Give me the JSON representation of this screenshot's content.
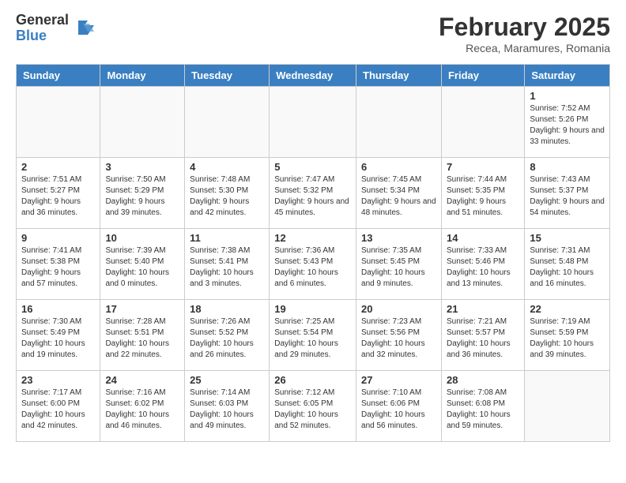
{
  "logo": {
    "general": "General",
    "blue": "Blue"
  },
  "header": {
    "month": "February 2025",
    "location": "Recea, Maramures, Romania"
  },
  "weekdays": [
    "Sunday",
    "Monday",
    "Tuesday",
    "Wednesday",
    "Thursday",
    "Friday",
    "Saturday"
  ],
  "weeks": [
    [
      {
        "day": "",
        "info": ""
      },
      {
        "day": "",
        "info": ""
      },
      {
        "day": "",
        "info": ""
      },
      {
        "day": "",
        "info": ""
      },
      {
        "day": "",
        "info": ""
      },
      {
        "day": "",
        "info": ""
      },
      {
        "day": "1",
        "info": "Sunrise: 7:52 AM\nSunset: 5:26 PM\nDaylight: 9 hours and 33 minutes."
      }
    ],
    [
      {
        "day": "2",
        "info": "Sunrise: 7:51 AM\nSunset: 5:27 PM\nDaylight: 9 hours and 36 minutes."
      },
      {
        "day": "3",
        "info": "Sunrise: 7:50 AM\nSunset: 5:29 PM\nDaylight: 9 hours and 39 minutes."
      },
      {
        "day": "4",
        "info": "Sunrise: 7:48 AM\nSunset: 5:30 PM\nDaylight: 9 hours and 42 minutes."
      },
      {
        "day": "5",
        "info": "Sunrise: 7:47 AM\nSunset: 5:32 PM\nDaylight: 9 hours and 45 minutes."
      },
      {
        "day": "6",
        "info": "Sunrise: 7:45 AM\nSunset: 5:34 PM\nDaylight: 9 hours and 48 minutes."
      },
      {
        "day": "7",
        "info": "Sunrise: 7:44 AM\nSunset: 5:35 PM\nDaylight: 9 hours and 51 minutes."
      },
      {
        "day": "8",
        "info": "Sunrise: 7:43 AM\nSunset: 5:37 PM\nDaylight: 9 hours and 54 minutes."
      }
    ],
    [
      {
        "day": "9",
        "info": "Sunrise: 7:41 AM\nSunset: 5:38 PM\nDaylight: 9 hours and 57 minutes."
      },
      {
        "day": "10",
        "info": "Sunrise: 7:39 AM\nSunset: 5:40 PM\nDaylight: 10 hours and 0 minutes."
      },
      {
        "day": "11",
        "info": "Sunrise: 7:38 AM\nSunset: 5:41 PM\nDaylight: 10 hours and 3 minutes."
      },
      {
        "day": "12",
        "info": "Sunrise: 7:36 AM\nSunset: 5:43 PM\nDaylight: 10 hours and 6 minutes."
      },
      {
        "day": "13",
        "info": "Sunrise: 7:35 AM\nSunset: 5:45 PM\nDaylight: 10 hours and 9 minutes."
      },
      {
        "day": "14",
        "info": "Sunrise: 7:33 AM\nSunset: 5:46 PM\nDaylight: 10 hours and 13 minutes."
      },
      {
        "day": "15",
        "info": "Sunrise: 7:31 AM\nSunset: 5:48 PM\nDaylight: 10 hours and 16 minutes."
      }
    ],
    [
      {
        "day": "16",
        "info": "Sunrise: 7:30 AM\nSunset: 5:49 PM\nDaylight: 10 hours and 19 minutes."
      },
      {
        "day": "17",
        "info": "Sunrise: 7:28 AM\nSunset: 5:51 PM\nDaylight: 10 hours and 22 minutes."
      },
      {
        "day": "18",
        "info": "Sunrise: 7:26 AM\nSunset: 5:52 PM\nDaylight: 10 hours and 26 minutes."
      },
      {
        "day": "19",
        "info": "Sunrise: 7:25 AM\nSunset: 5:54 PM\nDaylight: 10 hours and 29 minutes."
      },
      {
        "day": "20",
        "info": "Sunrise: 7:23 AM\nSunset: 5:56 PM\nDaylight: 10 hours and 32 minutes."
      },
      {
        "day": "21",
        "info": "Sunrise: 7:21 AM\nSunset: 5:57 PM\nDaylight: 10 hours and 36 minutes."
      },
      {
        "day": "22",
        "info": "Sunrise: 7:19 AM\nSunset: 5:59 PM\nDaylight: 10 hours and 39 minutes."
      }
    ],
    [
      {
        "day": "23",
        "info": "Sunrise: 7:17 AM\nSunset: 6:00 PM\nDaylight: 10 hours and 42 minutes."
      },
      {
        "day": "24",
        "info": "Sunrise: 7:16 AM\nSunset: 6:02 PM\nDaylight: 10 hours and 46 minutes."
      },
      {
        "day": "25",
        "info": "Sunrise: 7:14 AM\nSunset: 6:03 PM\nDaylight: 10 hours and 49 minutes."
      },
      {
        "day": "26",
        "info": "Sunrise: 7:12 AM\nSunset: 6:05 PM\nDaylight: 10 hours and 52 minutes."
      },
      {
        "day": "27",
        "info": "Sunrise: 7:10 AM\nSunset: 6:06 PM\nDaylight: 10 hours and 56 minutes."
      },
      {
        "day": "28",
        "info": "Sunrise: 7:08 AM\nSunset: 6:08 PM\nDaylight: 10 hours and 59 minutes."
      },
      {
        "day": "",
        "info": ""
      }
    ]
  ]
}
